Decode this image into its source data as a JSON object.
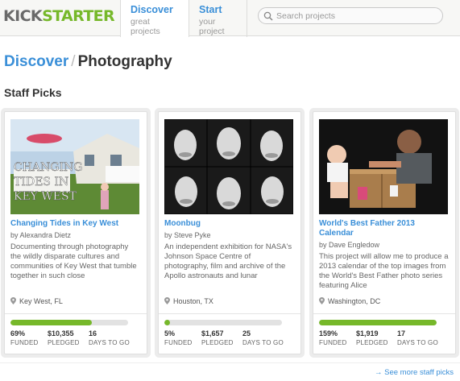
{
  "header": {
    "logo_left": "KICK",
    "logo_right": "STARTER",
    "tabs": [
      {
        "title": "Discover",
        "subtitle": "great projects"
      },
      {
        "title": "Start",
        "subtitle": "your project"
      }
    ],
    "search_placeholder": "Search projects"
  },
  "breadcrumb": {
    "link": "Discover",
    "separator": "/",
    "current": "Photography"
  },
  "section_title": "Staff Picks",
  "cards": [
    {
      "title": "Changing Tides in Key West",
      "author": "by Alexandra Dietz",
      "description": "Documenting through photography the wildly disparate cultures and communities of Key West that tumble together in such close",
      "image_text": "CHANGING TIDES IN KEY WEST",
      "location": "Key West, FL",
      "progress": 0.69,
      "funded": "69%",
      "pledged": "$10,355",
      "days": "16"
    },
    {
      "title": "Moonbug",
      "author": "by Steve Pyke",
      "description": "An independent exhibition for NASA's Johnson Space Centre of photography, film and archive of the Apollo astronauts and lunar",
      "location": "Houston, TX",
      "progress": 0.05,
      "funded": "5%",
      "pledged": "$1,657",
      "days": "25"
    },
    {
      "title": "World's Best Father 2013 Calendar",
      "author": "by Dave Engledow",
      "description": "This project will allow me to produce a 2013 calendar of the top images from the World's Best Father photo series featuring Alice",
      "location": "Washington, DC",
      "progress": 1.0,
      "funded": "159%",
      "pledged": "$1,919",
      "days": "17"
    }
  ],
  "stat_labels": {
    "funded": "FUNDED",
    "pledged": "PLEDGED",
    "days": "DAYS TO GO"
  },
  "more_link": "→ See more staff picks",
  "colors": {
    "accent": "#3a8fd8",
    "brand_green": "#76b82a"
  }
}
